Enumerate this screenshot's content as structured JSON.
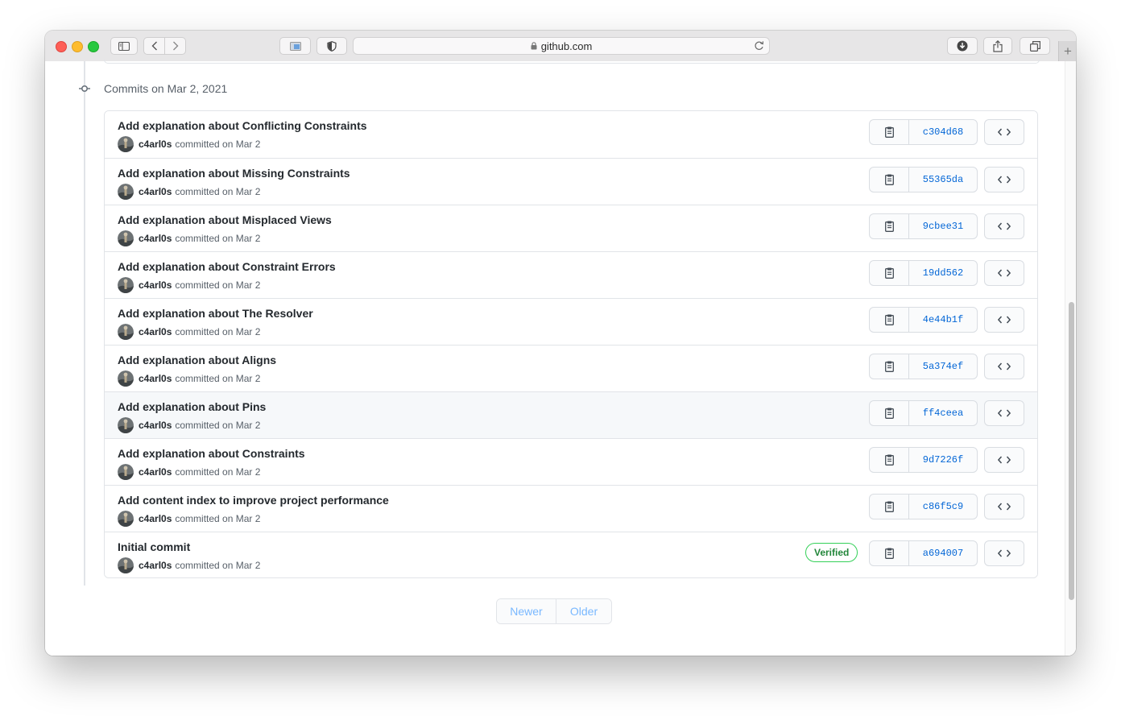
{
  "browser": {
    "url": "github.com",
    "new_tab_glyph": "+"
  },
  "section": {
    "date_header": "Commits on Mar 2, 2021"
  },
  "commits": [
    {
      "title": "Add explanation about Conflicting Constraints",
      "author": "c4arl0s",
      "meta": "committed on Mar 2",
      "sha": "c304d68",
      "verified": ""
    },
    {
      "title": "Add explanation about Missing Constraints",
      "author": "c4arl0s",
      "meta": "committed on Mar 2",
      "sha": "55365da",
      "verified": ""
    },
    {
      "title": "Add explanation about Misplaced Views",
      "author": "c4arl0s",
      "meta": "committed on Mar 2",
      "sha": "9cbee31",
      "verified": ""
    },
    {
      "title": "Add explanation about Constraint Errors",
      "author": "c4arl0s",
      "meta": "committed on Mar 2",
      "sha": "19dd562",
      "verified": ""
    },
    {
      "title": "Add explanation about The Resolver",
      "author": "c4arl0s",
      "meta": "committed on Mar 2",
      "sha": "4e44b1f",
      "verified": ""
    },
    {
      "title": "Add explanation about Aligns",
      "author": "c4arl0s",
      "meta": "committed on Mar 2",
      "sha": "5a374ef",
      "verified": ""
    },
    {
      "title": "Add explanation about Pins",
      "author": "c4arl0s",
      "meta": "committed on Mar 2",
      "sha": "ff4ceea",
      "verified": ""
    },
    {
      "title": "Add explanation about Constraints",
      "author": "c4arl0s",
      "meta": "committed on Mar 2",
      "sha": "9d7226f",
      "verified": ""
    },
    {
      "title": "Add content index to improve project performance",
      "author": "c4arl0s",
      "meta": "committed on Mar 2",
      "sha": "c86f5c9",
      "verified": ""
    },
    {
      "title": "Initial commit",
      "author": "c4arl0s",
      "meta": "committed on Mar 2",
      "sha": "a694007",
      "verified": "Verified"
    }
  ],
  "hovered_row": 6,
  "pagination": {
    "newer_label": "Newer",
    "older_label": "Older"
  },
  "colors": {
    "link_blue": "#0366d6",
    "verified_green": "#22863a",
    "pager_disabled": "#79b8ff"
  }
}
